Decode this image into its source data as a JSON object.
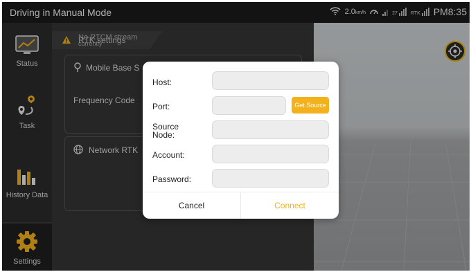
{
  "status_bar": {
    "title": "Driving in Manual Mode",
    "speed_value": "2.0",
    "speed_unit": "km/h",
    "satellite_count": "27",
    "rtk_label": "RTK",
    "time": "PM8:35"
  },
  "sidebar": {
    "items": [
      {
        "label": "Status",
        "icon": "chart-line-icon"
      },
      {
        "label": "Task",
        "icon": "route-icon"
      },
      {
        "label": "History Data",
        "icon": "bar-chart-icon"
      },
      {
        "label": "Settings",
        "icon": "gear-icon"
      }
    ]
  },
  "settings_panel": {
    "header_alert_line1": "No RTCM stream",
    "header_alert_line2": "currently",
    "header_title": "RTK settings",
    "mobile_base_label": "Mobile Base S",
    "frequency_code_label": "Frequency Code",
    "network_rtk_label": "Network RTK"
  },
  "dialog": {
    "host_label": "Host:",
    "port_label": "Port:",
    "get_source_label": "Get Source",
    "source_node_label_line1": "Source",
    "source_node_label_line2": "Node:",
    "account_label": "Account:",
    "password_label": "Password:",
    "cancel_label": "Cancel",
    "connect_label": "Connect",
    "host_value": "",
    "port_value": "",
    "source_node_value": "",
    "account_value": "",
    "password_value": ""
  },
  "colors": {
    "accent": "#f3b21b",
    "status_bar_bg": "#1b1b1b",
    "sidebar_bg": "#2b2b2b",
    "panel_bg": "#353535"
  }
}
